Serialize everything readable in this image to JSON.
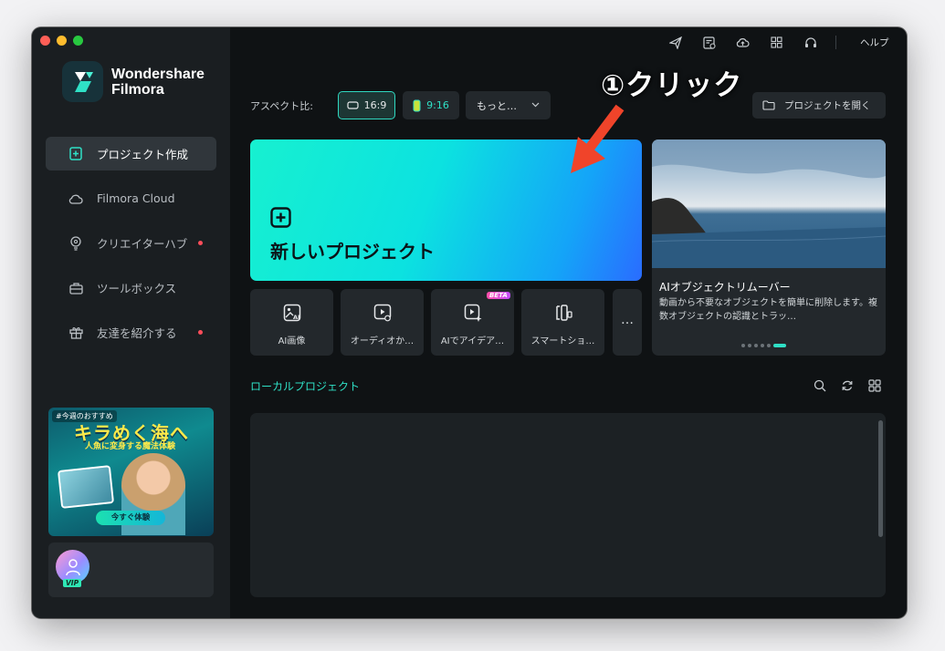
{
  "app": {
    "brand_line1": "Wondershare",
    "brand_line2": "Filmora"
  },
  "sidebar": {
    "items": [
      {
        "label": "プロジェクト作成",
        "icon": "new-project-icon",
        "active": true,
        "badge": false
      },
      {
        "label": "Filmora Cloud",
        "icon": "cloud-icon",
        "active": false,
        "badge": false
      },
      {
        "label": "クリエイターハブ",
        "icon": "bulb-icon",
        "active": false,
        "badge": true
      },
      {
        "label": "ツールボックス",
        "icon": "toolbox-icon",
        "active": false,
        "badge": false
      },
      {
        "label": "友達を紹介する",
        "icon": "gift-icon",
        "active": false,
        "badge": true
      }
    ],
    "promo": {
      "tag": "#今週のおすすめ",
      "title": "キラめく海へ",
      "subtitle": "人魚に変身する魔法体験",
      "button": "今すぐ体験"
    },
    "account": {
      "badge": "VIP"
    }
  },
  "topbar": {
    "icons": [
      "send-icon",
      "task-icon",
      "cloud-upload-icon",
      "apps-grid-icon",
      "headset-icon"
    ],
    "help_label": "ヘルプ"
  },
  "aspect": {
    "label": "アスペクト比:",
    "options": [
      "16:9",
      "9:16"
    ],
    "selected": "16:9",
    "more_label": "もっと…"
  },
  "open_project_label": "プロジェクトを開く",
  "annotation": "①クリック",
  "new_project_label": "新しいプロジェクト",
  "tools": [
    {
      "label": "AI画像",
      "icon": "ai-image-icon",
      "beta": false
    },
    {
      "label": "オーディオか…",
      "icon": "audio-to-video-icon",
      "beta": false
    },
    {
      "label": "AIでアイデア…",
      "icon": "ai-idea-icon",
      "beta": true
    },
    {
      "label": "スマートショ…",
      "icon": "smart-short-icon",
      "beta": false
    }
  ],
  "beta_label": "BETA",
  "more_tools_label": "…",
  "feature": {
    "title": "AIオブジェクトリムーバー",
    "description": "動画から不要なオブジェクトを簡単に削除します。複数オブジェクトの認識とトラッ…",
    "slides": 6,
    "current_slide": 6
  },
  "local": {
    "title": "ローカルプロジェクト"
  },
  "colors": {
    "accent": "#2fe0c6",
    "badge_red": "#ff4d5a",
    "annotation_arrow": "#f0442a"
  }
}
